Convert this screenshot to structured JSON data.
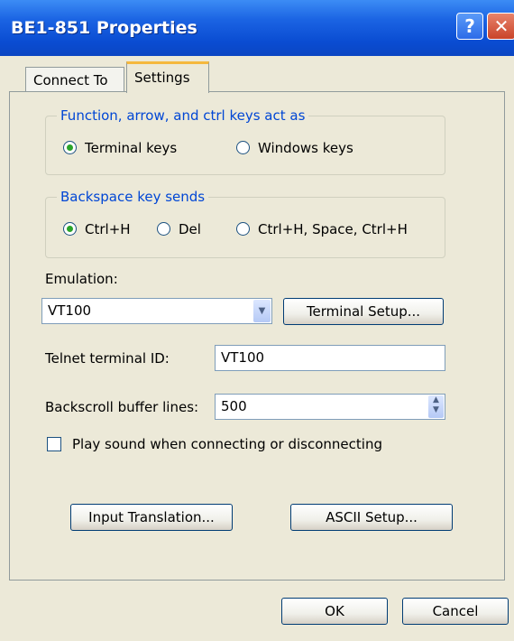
{
  "window": {
    "title": "BE1-851 Properties",
    "help_glyph": "?",
    "close_glyph": "✕"
  },
  "tabs": [
    {
      "label": "Connect To"
    },
    {
      "label": "Settings"
    }
  ],
  "function_group": {
    "legend": "Function, arrow, and ctrl keys act as",
    "options": [
      {
        "label": "Terminal keys",
        "selected": true
      },
      {
        "label": "Windows keys",
        "selected": false
      }
    ]
  },
  "backspace_group": {
    "legend": "Backspace key sends",
    "options": [
      {
        "label": "Ctrl+H",
        "selected": true
      },
      {
        "label": "Del",
        "selected": false
      },
      {
        "label": "Ctrl+H, Space, Ctrl+H",
        "selected": false
      }
    ]
  },
  "emulation": {
    "label": "Emulation:",
    "value": "VT100",
    "setup_button": "Terminal Setup..."
  },
  "telnet": {
    "label": "Telnet terminal ID:",
    "value": "VT100"
  },
  "backscroll": {
    "label": "Backscroll buffer lines:",
    "value": "500"
  },
  "sound": {
    "label": "Play sound when connecting or disconnecting",
    "checked": false
  },
  "buttons": {
    "input_translation": "Input Translation...",
    "ascii_setup": "ASCII Setup...",
    "ok": "OK",
    "cancel": "Cancel"
  },
  "colors": {
    "title_bar": "#0A4CD2",
    "legend_text": "#0046D5",
    "dialog_bg": "#ECE9D8"
  }
}
